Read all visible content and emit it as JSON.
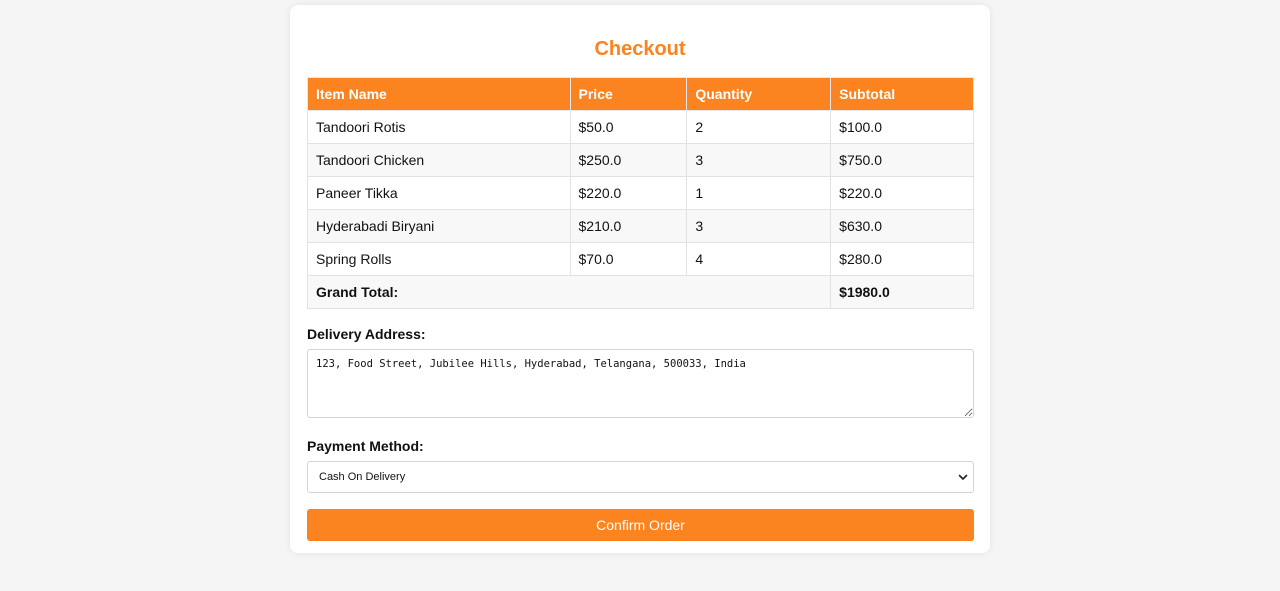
{
  "page": {
    "title": "Checkout"
  },
  "table": {
    "headers": [
      "Item Name",
      "Price",
      "Quantity",
      "Subtotal"
    ],
    "rows": [
      {
        "name": "Tandoori Rotis",
        "price": "$50.0",
        "quantity": "2",
        "subtotal": "$100.0"
      },
      {
        "name": "Tandoori Chicken",
        "price": "$250.0",
        "quantity": "3",
        "subtotal": "$750.0"
      },
      {
        "name": "Paneer Tikka",
        "price": "$220.0",
        "quantity": "1",
        "subtotal": "$220.0"
      },
      {
        "name": "Hyderabadi Biryani",
        "price": "$210.0",
        "quantity": "3",
        "subtotal": "$630.0"
      },
      {
        "name": "Spring Rolls",
        "price": "$70.0",
        "quantity": "4",
        "subtotal": "$280.0"
      }
    ],
    "grand_total_label": "Grand Total:",
    "grand_total_value": "$1980.0"
  },
  "delivery": {
    "label": "Delivery Address:",
    "value": "123, Food Street, Jubilee Hills, Hyderabad, Telangana, 500033, India"
  },
  "payment": {
    "label": "Payment Method:",
    "selected": "Cash On Delivery"
  },
  "actions": {
    "confirm_label": "Confirm Order"
  },
  "colors": {
    "accent": "#fb8420",
    "background": "#f5f5f5"
  },
  "icons": {
    "select_arrow": "chevron-down-icon"
  }
}
